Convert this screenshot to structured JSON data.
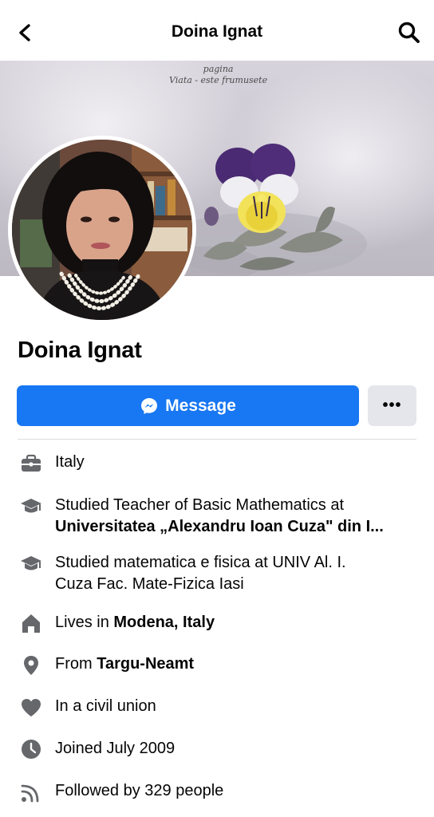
{
  "header": {
    "title": "Doina Ignat"
  },
  "cover": {
    "caption_line1": "pagina",
    "caption_line2": "Viata - este frumusete"
  },
  "profile": {
    "name": "Doina Ignat"
  },
  "actions": {
    "message_label": "Message",
    "more_label": "•••"
  },
  "details": {
    "work": "Italy",
    "education1_prefix": "Studied Teacher of Basic Mathematics at",
    "education1_school": "Universitatea „Alexandru Ioan Cuza\" din I...",
    "education2_line1": "Studied matematica e fisica at UNIV Al. I.",
    "education2_line2": "Cuza Fac. Mate-Fizica Iasi",
    "lives_prefix": "Lives in ",
    "lives_place": "Modena, Italy",
    "from_prefix": "From ",
    "from_place": "Targu-Neamt",
    "relationship": "In a civil union",
    "joined": "Joined July 2009",
    "followers": "Followed by 329 people"
  },
  "icons": {
    "back": "back-arrow-icon",
    "search": "search-icon",
    "messenger": "messenger-icon",
    "work": "briefcase-icon",
    "education": "graduation-cap-icon",
    "home": "house-icon",
    "location": "location-pin-icon",
    "relationship": "heart-icon",
    "joined": "clock-icon",
    "followers": "rss-feed-icon"
  },
  "colors": {
    "accent": "#1877f2",
    "secondary_button": "#e4e6eb",
    "icon_gray": "#65676b"
  }
}
